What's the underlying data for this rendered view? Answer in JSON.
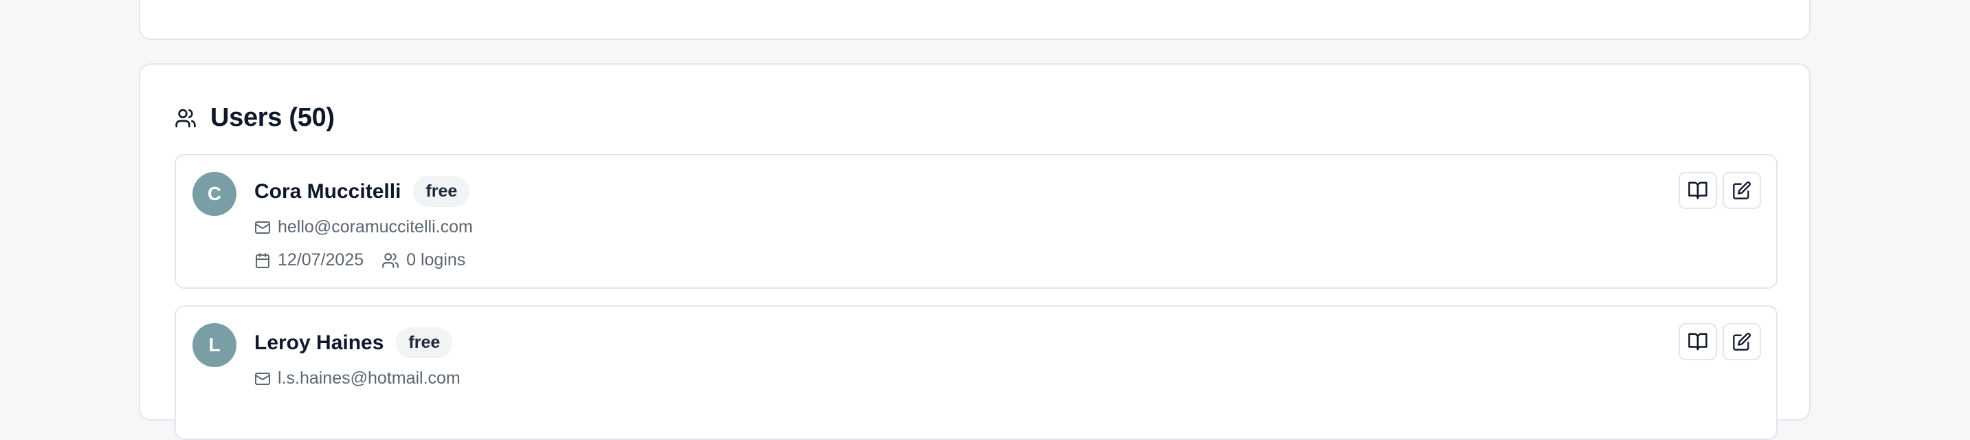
{
  "users_section": {
    "title": "Users (50)",
    "icon": "users-icon"
  },
  "users": [
    {
      "initial": "C",
      "name": "Cora Muccitelli",
      "plan": "free",
      "email": "hello@coramuccitelli.com",
      "date": "12/07/2025",
      "logins": "0 logins"
    },
    {
      "initial": "L",
      "name": "Leroy Haines",
      "plan": "free",
      "email": "l.s.haines@hotmail.com"
    }
  ],
  "colors": {
    "avatar_bg": "#7a9ea6",
    "badge_bg": "#f1f3f5",
    "border": "#e3e6ea",
    "page_bg": "#f6f7f9"
  }
}
